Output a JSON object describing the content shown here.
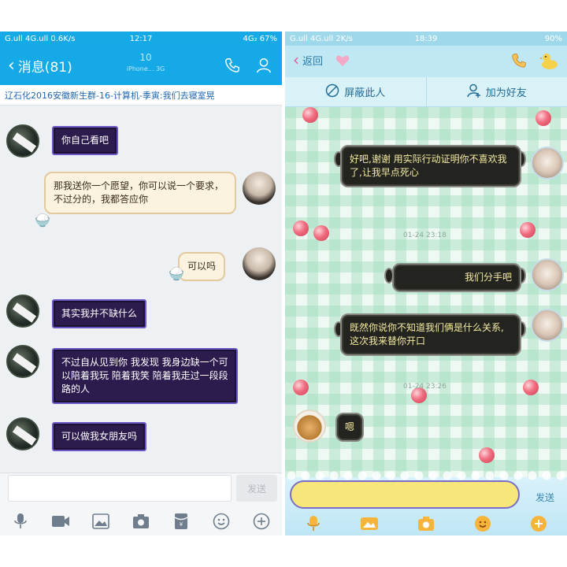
{
  "left": {
    "status": {
      "signal": "G.ull 4G.ull 0.6K/s",
      "time": "12:17",
      "right": "4G₂ 67%"
    },
    "header": {
      "back_label": "消息(81)",
      "title_blur": "10",
      "subtitle_blur": "iPhone... 3G"
    },
    "group_bar": "辽石化2016安徽新生群-16-计算机-季寅:我们去寝室晃",
    "messages": [
      {
        "side": "left",
        "text": "你自己看吧"
      },
      {
        "side": "right",
        "text": "那我送你一个愿望，你可以说一个要求，不过分的，我都答应你"
      },
      {
        "side": "right",
        "text": "可以吗"
      },
      {
        "side": "left",
        "text": "其实我并不缺什么"
      },
      {
        "side": "left",
        "text": "不过自从见到你   我发现  我身边缺一个可以陪着我玩 陪着我笑 陪着我走过一段段路的人"
      },
      {
        "side": "left",
        "text": "可以做我女朋友吗"
      }
    ],
    "input": {
      "placeholder": "",
      "send_label": "发送"
    },
    "toolbar": [
      "mic-icon",
      "video-icon",
      "image-icon",
      "camera-icon",
      "redpacket-icon",
      "emoji-icon",
      "plus-icon"
    ]
  },
  "right": {
    "status": {
      "signal": "G.ull 4G.ull 2K/s",
      "time": "18:39",
      "right": "90%"
    },
    "header": {
      "back_label": "返回"
    },
    "actions": {
      "block": "屏蔽此人",
      "add_friend": "加为好友"
    },
    "messages": [
      {
        "side": "right",
        "text": "好吧,谢谢    用实际行动证明你不喜欢我了,让我早点死心"
      },
      {
        "side": "right",
        "text": "我们分手吧"
      },
      {
        "side": "right",
        "text": "既然你说你不知道我们俩是什么关系,这次我来替你开口"
      },
      {
        "side": "left",
        "text": "嗯"
      }
    ],
    "times": [
      "01-24 23:18",
      "01-24 23:26"
    ],
    "input": {
      "send_label": "发送"
    },
    "colors": {
      "bubble": "#23241f",
      "bubble_text": "#f4eaa2",
      "input": "#f7e67a"
    }
  }
}
